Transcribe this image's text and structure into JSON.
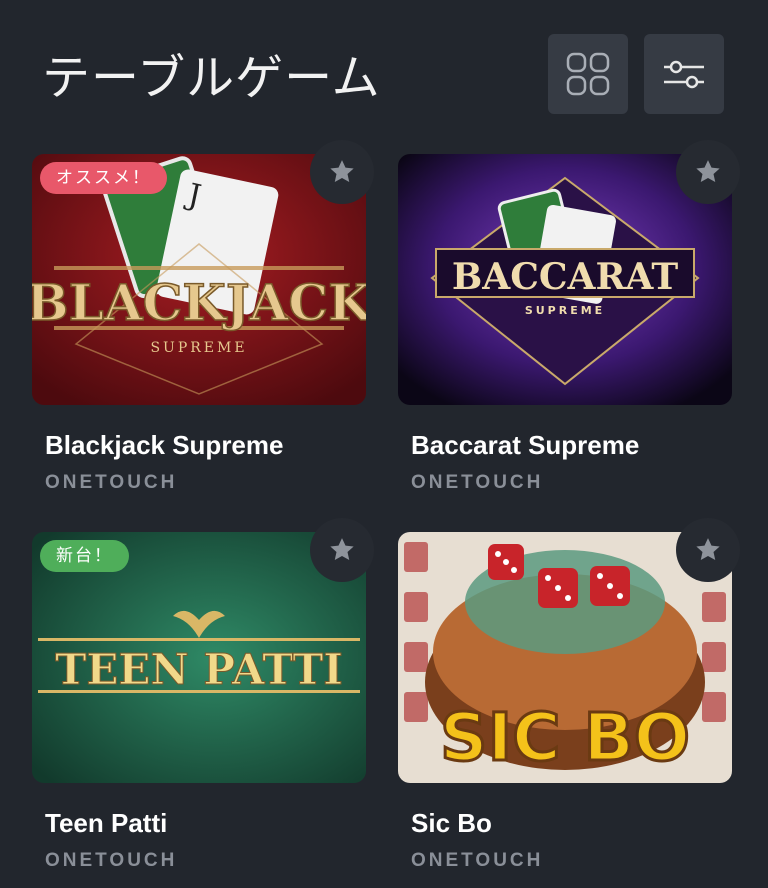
{
  "header": {
    "title": "テーブルゲーム",
    "grid_icon": "grid-view-icon",
    "filter_icon": "filter-sliders-icon"
  },
  "games": [
    {
      "name": "Blackjack Supreme",
      "provider": "ONETOUCH",
      "badge": "オススメ！",
      "badge_color": "#e8586a",
      "art_title": "BLACKJACK",
      "art_subtitle": "SUPREME"
    },
    {
      "name": "Baccarat Supreme",
      "provider": "ONETOUCH",
      "badge": "",
      "art_title": "BACCARAT",
      "art_subtitle": "SUPREME"
    },
    {
      "name": "Teen Patti",
      "provider": "ONETOUCH",
      "badge": "新台！",
      "badge_color": "#4fae5a",
      "art_title": "TEEN PATTI",
      "art_subtitle": ""
    },
    {
      "name": "Sic Bo",
      "provider": "ONETOUCH",
      "badge": "",
      "art_title": "SIC BO",
      "art_subtitle": ""
    }
  ],
  "colors": {
    "background": "#22262d",
    "button_bg": "#363b44",
    "provider_text": "#8a8f98"
  }
}
